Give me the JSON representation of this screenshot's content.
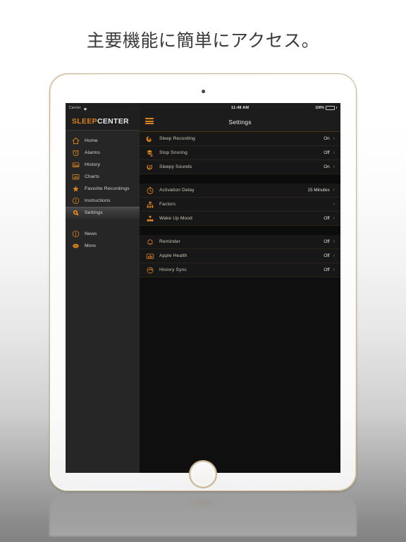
{
  "headline": "主要機能に簡単にアクセス。",
  "colors": {
    "accent_orange": "#d9821f",
    "sidebar_bg": "#262626",
    "screen_bg": "#0f0f0f",
    "battery_green": "#4cd964"
  },
  "device": {
    "status_bar": {
      "carrier": "Carrier",
      "wifi_icon": "wifi-icon",
      "time": "11:48 AM",
      "battery_percent": "100%",
      "battery_icon": "battery-full-icon"
    },
    "sidebar": {
      "logo_first": "SLEEP",
      "logo_second": "CENTER",
      "items": [
        {
          "label": "Home",
          "icon": "home-icon",
          "active": false
        },
        {
          "label": "Alarms",
          "icon": "alarm-clock-icon",
          "active": false
        },
        {
          "label": "History",
          "icon": "bed-icon",
          "active": false
        },
        {
          "label": "Charts",
          "icon": "bar-chart-icon",
          "active": false
        },
        {
          "label": "Favorite Recordings",
          "icon": "star-icon",
          "active": false
        },
        {
          "label": "Instructions",
          "icon": "info-circle-icon",
          "active": false
        },
        {
          "label": "Settings",
          "icon": "gear-icon",
          "active": true
        }
      ],
      "secondary_items": [
        {
          "label": "News",
          "icon": "info-circle-icon"
        },
        {
          "label": "More",
          "icon": "ellipsis-icon"
        }
      ]
    },
    "navbar": {
      "menu_icon": "hamburger-menu-icon",
      "title": "Settings"
    },
    "settings_groups": [
      {
        "rows": [
          {
            "label": "Sleep Recording",
            "value": "On",
            "icon": "moon-record-icon"
          },
          {
            "label": "Stop Snoring",
            "value": "Off",
            "icon": "snoring-zzz-icon"
          },
          {
            "label": "Sleepy Sounds",
            "value": "On",
            "icon": "music-note-icon"
          }
        ]
      },
      {
        "rows": [
          {
            "label": "Activation Delay",
            "value": "15 Minutes",
            "icon": "stopwatch-icon"
          },
          {
            "label": "Factors",
            "value": "",
            "icon": "factors-network-icon"
          },
          {
            "label": "Wake Up Mood",
            "value": "Off",
            "icon": "mood-dots-icon"
          }
        ]
      },
      {
        "rows": [
          {
            "label": "Reminder",
            "value": "Off",
            "icon": "bell-icon"
          },
          {
            "label": "Apple Health",
            "value": "Off",
            "icon": "health-chart-icon"
          },
          {
            "label": "History Sync",
            "value": "Off",
            "icon": "sync-cloud-icon"
          }
        ]
      }
    ],
    "chevron_glyph": "›"
  }
}
